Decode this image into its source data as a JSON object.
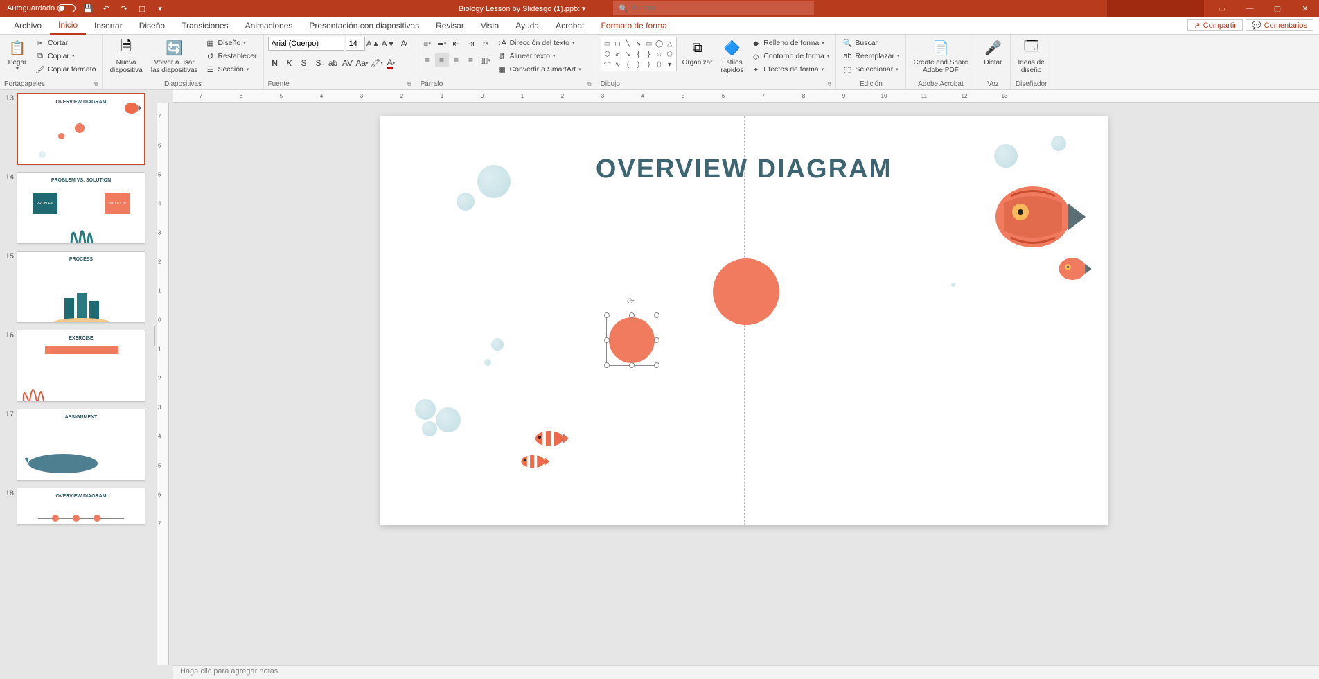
{
  "titlebar": {
    "autosave_label": "Autoguardado",
    "doctitle": "Biology Lesson by Slidesgo (1).pptx ▾",
    "search_placeholder": "Buscar"
  },
  "menu": {
    "tabs": [
      "Archivo",
      "Inicio",
      "Insertar",
      "Diseño",
      "Transiciones",
      "Animaciones",
      "Presentación con diapositivas",
      "Revisar",
      "Vista",
      "Ayuda",
      "Acrobat",
      "Formato de forma"
    ],
    "share": "Compartir",
    "comments": "Comentarios"
  },
  "ribbon": {
    "clipboard": {
      "paste": "Pegar",
      "cut": "Cortar",
      "copy": "Copiar",
      "format_painter": "Copiar formato",
      "label": "Portapapeles"
    },
    "slides": {
      "new": "Nueva\ndiapositiva",
      "reuse": "Volver a usar\nlas diapositivas",
      "layout": "Diseño",
      "reset": "Restablecer",
      "section": "Sección",
      "label": "Diapositivas"
    },
    "font": {
      "name": "Arial (Cuerpo)",
      "size": "14",
      "label": "Fuente"
    },
    "paragraph": {
      "direction": "Dirección del texto",
      "align": "Alinear texto",
      "smartart": "Convertir a SmartArt",
      "label": "Párrafo"
    },
    "drawing": {
      "arrange": "Organizar",
      "quick_styles": "Estilos\nrápidos",
      "fill": "Relleno de forma",
      "outline": "Contorno de forma",
      "effects": "Efectos de forma",
      "label": "Dibujo"
    },
    "editing": {
      "find": "Buscar",
      "replace": "Reemplazar",
      "select": "Seleccionar",
      "label": "Edición"
    },
    "acrobat": {
      "create": "Create and Share\nAdobe PDF",
      "label": "Adobe Acrobat"
    },
    "voice": {
      "dictate": "Dictar",
      "label": "Voz"
    },
    "designer": {
      "ideas": "Ideas de\ndiseño",
      "label": "Diseñador"
    }
  },
  "thumbnails": {
    "t13": {
      "num": "13",
      "title": "OVERVIEW DIAGRAM"
    },
    "t14": {
      "num": "14",
      "title": "PROBLEM VS. SOLUTION",
      "problem": "PROBLEM",
      "solution": "SOLUTION"
    },
    "t15": {
      "num": "15",
      "title": "PROCESS"
    },
    "t16": {
      "num": "16",
      "title": "EXERCISE"
    },
    "t17": {
      "num": "17",
      "title": "ASSIGNMENT"
    },
    "t18": {
      "num": "18",
      "title": "OVERVIEW DIAGRAM"
    }
  },
  "slide": {
    "title": "OVERVIEW DIAGRAM"
  },
  "notes": {
    "placeholder": "Haga clic para agregar notas"
  },
  "ruler_h": [
    "7",
    "6",
    "5",
    "4",
    "3",
    "2",
    "1",
    "0",
    "1",
    "2",
    "3",
    "4",
    "5",
    "6",
    "7",
    "8",
    "9",
    "10",
    "11",
    "12",
    "13"
  ],
  "ruler_v": [
    "7",
    "6",
    "5",
    "4",
    "3",
    "2",
    "1",
    "0",
    "1",
    "2",
    "3",
    "4",
    "5",
    "6",
    "7"
  ]
}
